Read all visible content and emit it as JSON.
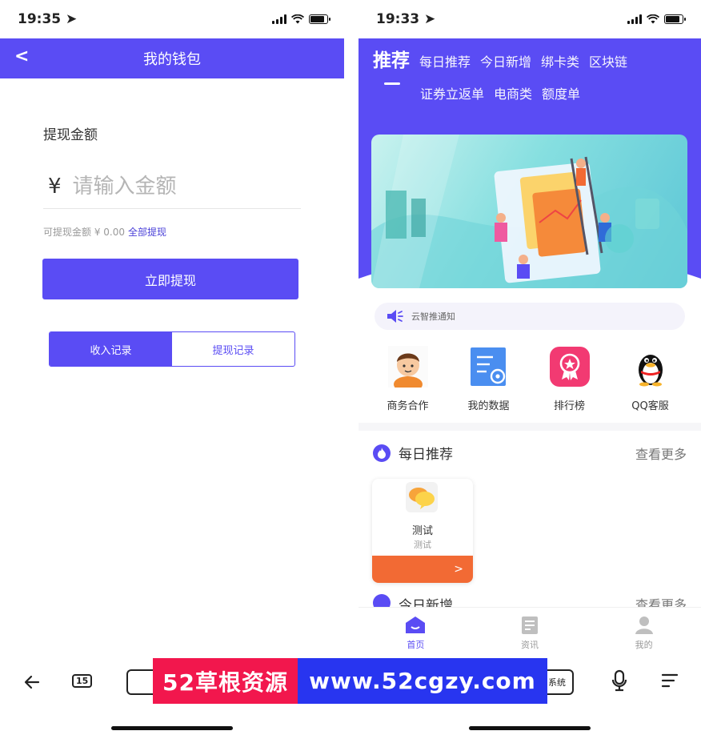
{
  "left_screen": {
    "status_time": "19:35",
    "header": {
      "back_label": "<",
      "title": "我的钱包"
    },
    "amount_label": "提现金额",
    "currency_symbol": "¥",
    "amount_placeholder": "请输入金额",
    "available_text": "可提现金额 ¥ 0.00",
    "withdraw_all_label": "全部提现",
    "withdraw_button_label": "立即提现",
    "records_tabs": [
      {
        "label": "收入记录",
        "active": true
      },
      {
        "label": "提现记录",
        "active": false
      }
    ],
    "browser_tab_count": "15"
  },
  "right_screen": {
    "status_time": "19:33",
    "tabs_row1": [
      "推荐",
      "每日推荐",
      "今日新增",
      "绑卡类",
      "区块链"
    ],
    "tabs_row2": [
      "证券立返单",
      "电商类",
      "额度单"
    ],
    "active_tab": "推荐",
    "notice_text": "云智推通知",
    "quick_actions": [
      {
        "label": "商务合作",
        "icon": "business-avatar-icon"
      },
      {
        "label": "我的数据",
        "icon": "data-document-icon"
      },
      {
        "label": "排行榜",
        "icon": "ranking-ribbon-icon"
      },
      {
        "label": "QQ客服",
        "icon": "qq-penguin-icon"
      }
    ],
    "section_daily": {
      "title": "每日推荐",
      "more": "查看更多"
    },
    "card": {
      "title": "测试",
      "subtitle": "测试",
      "arrow": ">"
    },
    "section_new": {
      "title": "今日新增",
      "more": "查看更多"
    },
    "bottom_nav": [
      {
        "label": "首页",
        "active": true
      },
      {
        "label": "资讯",
        "active": false
      },
      {
        "label": "我的",
        "active": false
      }
    ],
    "browser_button_label": "系统"
  },
  "watermark": {
    "left_text": "52草根资源",
    "right_text": "www.52cgzy.com"
  },
  "colors": {
    "primary": "#5a4cf4",
    "orange": "#f26a34",
    "watermark_red": "#f2174d",
    "watermark_blue": "#2835f0"
  }
}
